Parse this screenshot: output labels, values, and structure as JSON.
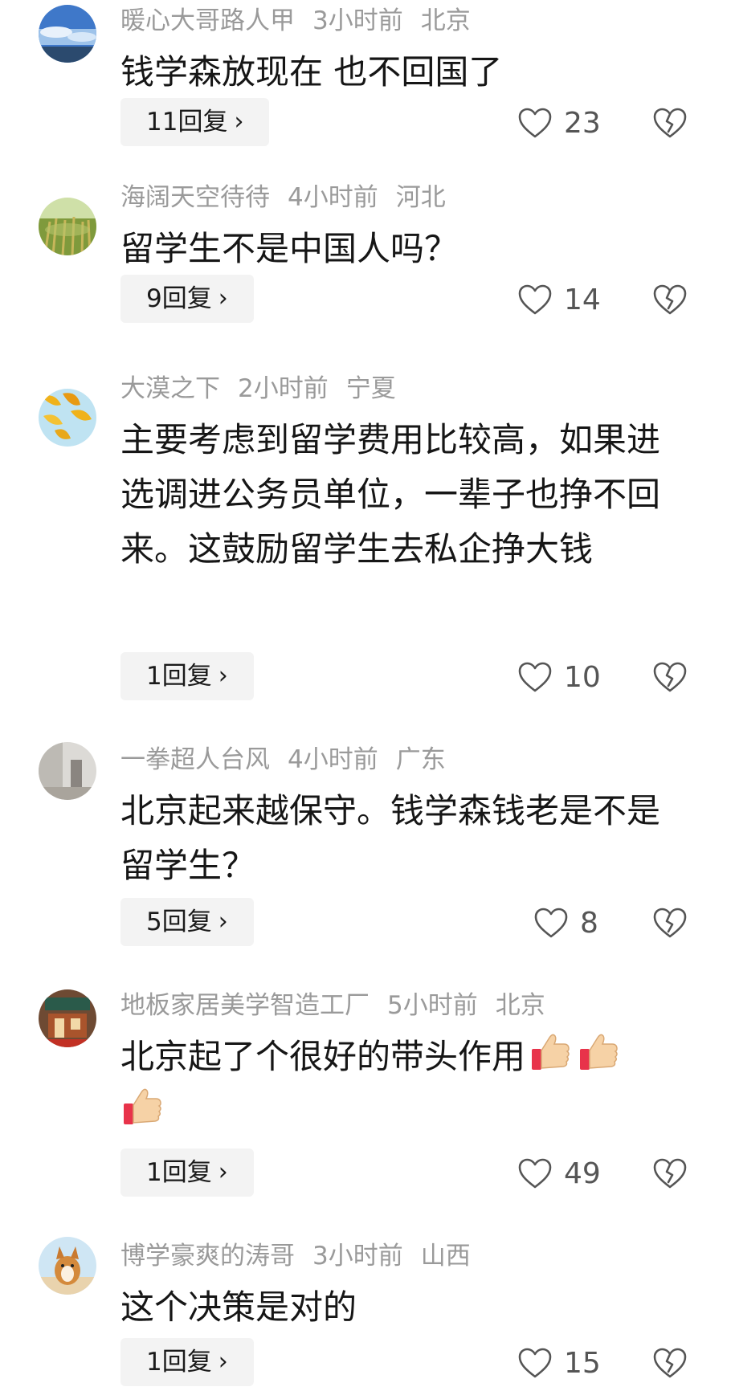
{
  "comments": [
    {
      "user": "暖心大哥路人甲",
      "time": "3小时前",
      "location": "北京",
      "text": "钱学森放现在 也不回国了",
      "replies": "11回复",
      "likes": "23",
      "avatar": "sky-landscape-avatar"
    },
    {
      "user": "海阔天空待待",
      "time": "4小时前",
      "location": "河北",
      "text": "留学生不是中国人吗？",
      "replies": "9回复",
      "likes": "14",
      "avatar": "wheat-field-avatar"
    },
    {
      "user": "大漠之下",
      "time": "2小时前",
      "location": "宁夏",
      "text": "主要考虑到留学费用比较高，如果进选调进公务员单位，一辈子也挣不回来。这鼓励留学生去私企挣大钱",
      "replies": "1回复",
      "likes": "10",
      "avatar": "ginkgo-leaves-avatar"
    },
    {
      "user": "一拳超人台风",
      "time": "4小时前",
      "location": "广东",
      "text": "北京起来越保守。钱学森钱老是不是留学生？",
      "replies": "5回复",
      "likes": "8",
      "avatar": "room-corner-avatar"
    },
    {
      "user": "地板家居美学智造工厂",
      "time": "5小时前",
      "location": "北京",
      "text": "北京起了个很好的带头作用",
      "emoji": "thumbs-up-emoji",
      "replies": "1回复",
      "likes": "49",
      "avatar": "storefront-avatar"
    },
    {
      "user": "博学豪爽的涛哥",
      "time": "3小时前",
      "location": "山西",
      "text": "这个决策是对的",
      "replies": "1回复",
      "likes": "15",
      "avatar": "corgi-dog-avatar"
    }
  ],
  "icons": {
    "like": "heart-outline-icon",
    "dislike": "broken-heart-icon",
    "reply_arrow": "chevron-right-icon"
  },
  "reply_chevron": "›",
  "colors": {
    "meta_text": "#9a9a9a",
    "body_text": "#161616",
    "reply_bg": "#f3f3f3",
    "icon_stroke": "#555555"
  }
}
